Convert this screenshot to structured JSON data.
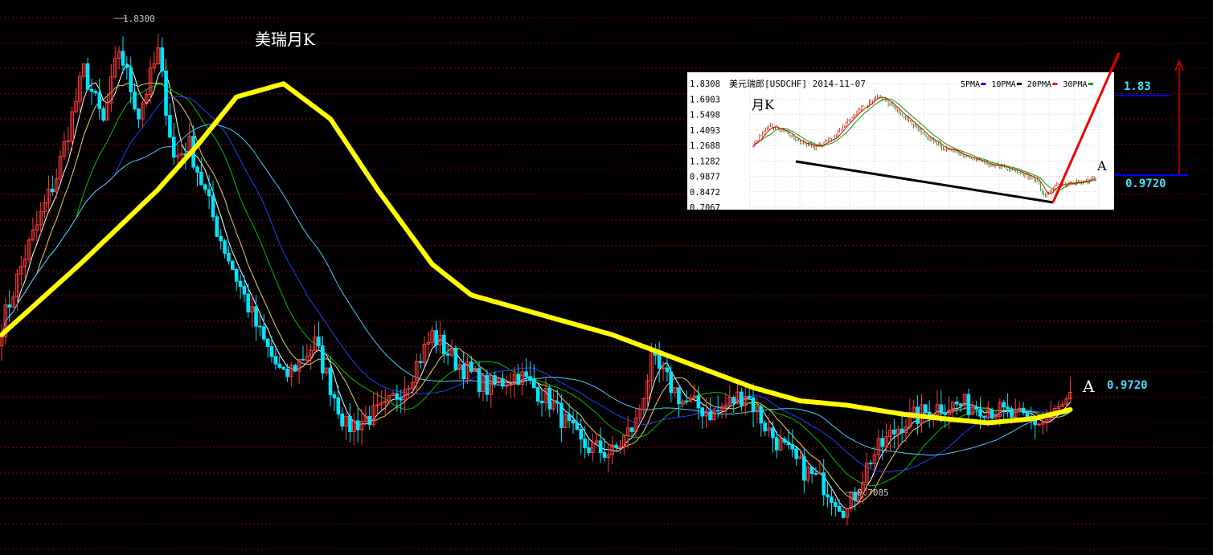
{
  "title": "美瑞月K",
  "colors": {
    "background": "#000000",
    "grid": "#8b0000",
    "up_candle": "#ff3b3b",
    "down_candle": "#00e5ff",
    "ma_thick": "#ffff00",
    "ma5": "#ffffff",
    "ma10": "#e8d060",
    "ma20": "#00c000",
    "ma30": "#2040ff",
    "ma60": "#40d0ff",
    "annotation_cyan": "#40e0ff",
    "annotation_white": "#ffffff"
  },
  "annotations": {
    "high_label": "1.8300",
    "low_label": "0.7085",
    "point_a_letter": "A",
    "point_a_value": "0.9720"
  },
  "chart_data": [
    {
      "type": "candlestick",
      "title": "美瑞月K",
      "ylim": [
        0.62,
        1.88
      ],
      "grid": true,
      "annotations": [
        {
          "text": "1.8300",
          "y": 1.83
        },
        {
          "text": "0.7085",
          "y": 0.7085
        },
        {
          "text": "A",
          "y": 0.972
        },
        {
          "text": "0.9720",
          "y": 0.972
        }
      ],
      "close_path": [
        [
          0,
          1.14
        ],
        [
          6,
          1.3
        ],
        [
          14,
          1.48
        ],
        [
          21,
          1.72
        ],
        [
          26,
          1.6
        ],
        [
          30,
          1.77
        ],
        [
          35,
          1.62
        ],
        [
          40,
          1.76
        ],
        [
          44,
          1.52
        ],
        [
          48,
          1.55
        ],
        [
          55,
          1.36
        ],
        [
          60,
          1.25
        ],
        [
          66,
          1.12
        ],
        [
          72,
          1.02
        ],
        [
          80,
          1.1
        ],
        [
          88,
          0.91
        ],
        [
          98,
          0.95
        ],
        [
          104,
          1.02
        ],
        [
          110,
          1.12
        ],
        [
          116,
          1.06
        ],
        [
          124,
          1.0
        ],
        [
          132,
          1.03
        ],
        [
          140,
          0.97
        ],
        [
          148,
          0.87
        ],
        [
          156,
          0.85
        ],
        [
          162,
          0.92
        ],
        [
          166,
          1.06
        ],
        [
          174,
          0.97
        ],
        [
          182,
          0.94
        ],
        [
          190,
          0.99
        ],
        [
          196,
          0.9
        ],
        [
          204,
          0.82
        ],
        [
          210,
          0.78
        ],
        [
          216,
          0.72
        ],
        [
          222,
          0.84
        ],
        [
          230,
          0.92
        ],
        [
          240,
          0.96
        ],
        [
          250,
          0.96
        ],
        [
          260,
          0.93
        ],
        [
          266,
          0.92
        ],
        [
          273,
          0.97
        ]
      ],
      "ma_thick_path": [
        [
          0,
          1.12
        ],
        [
          20,
          1.28
        ],
        [
          40,
          1.45
        ],
        [
          50,
          1.55
        ],
        [
          60,
          1.66
        ],
        [
          72,
          1.69
        ],
        [
          84,
          1.61
        ],
        [
          96,
          1.45
        ],
        [
          110,
          1.28
        ],
        [
          120,
          1.21
        ],
        [
          132,
          1.18
        ],
        [
          144,
          1.15
        ],
        [
          156,
          1.12
        ],
        [
          168,
          1.08
        ],
        [
          180,
          1.04
        ],
        [
          192,
          1.0
        ],
        [
          204,
          0.97
        ],
        [
          216,
          0.96
        ],
        [
          230,
          0.94
        ],
        [
          240,
          0.93
        ],
        [
          252,
          0.92
        ],
        [
          264,
          0.93
        ],
        [
          273,
          0.95
        ]
      ]
    },
    {
      "type": "candlestick",
      "title": "美元瑞郎[USDCHF] 2014-11-07",
      "subtitle": "月K",
      "ylim": [
        0.7067,
        1.8308
      ],
      "yticks": [
        "1.8308",
        "1.6903",
        "1.5498",
        "1.4093",
        "1.2688",
        "1.1282",
        "0.9877",
        "0.8472",
        "0.7067"
      ],
      "legend": [
        "5PMA",
        "10PMA",
        "20PMA",
        "30PMA"
      ],
      "legend_colors": [
        "#0000ff",
        "#000000",
        "#ff0000",
        "#00a000"
      ],
      "annotations": [
        {
          "text": "1.83",
          "y": 1.83
        },
        {
          "text": "A",
          "y": 0.972
        },
        {
          "text": "0.9720",
          "y": 0.972
        }
      ]
    }
  ]
}
